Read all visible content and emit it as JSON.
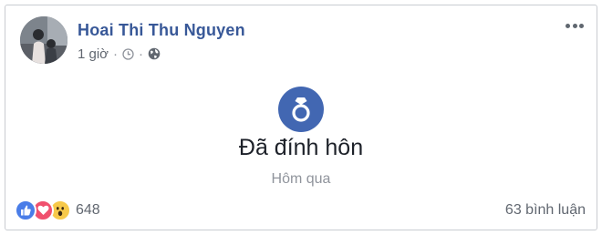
{
  "post": {
    "author": "Hoai Thi Thu Nguyen",
    "time": "1 giờ",
    "separator": "·",
    "icons": {
      "avatar": "profile-photo",
      "clock": "clock-icon",
      "privacy": "globe-icon",
      "more": "more-options-icon"
    }
  },
  "life_event": {
    "icon": "engagement-ring-icon",
    "title": "Đã đính hôn",
    "date": "Hôm qua",
    "accent_color": "#4267b2"
  },
  "footer": {
    "reactions": [
      "like",
      "love",
      "wow"
    ],
    "reaction_count": "648",
    "comments": "63 bình luận"
  }
}
